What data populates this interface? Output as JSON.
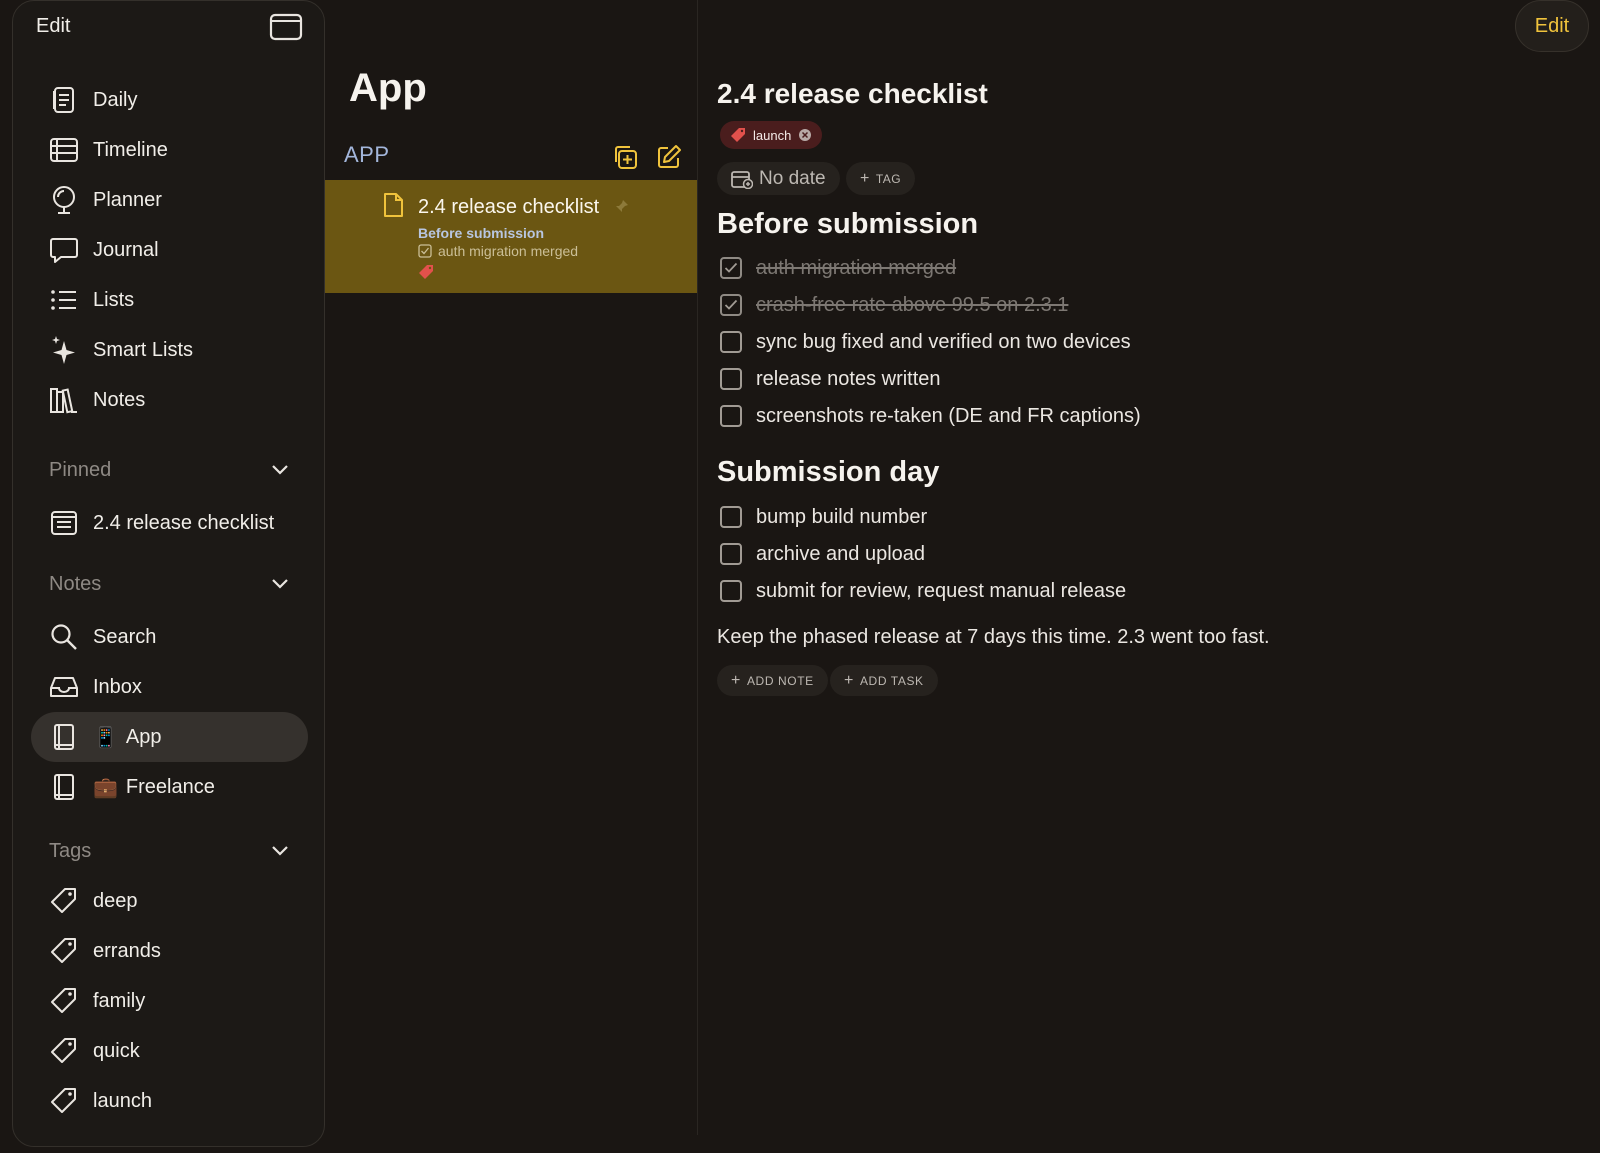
{
  "sidebar": {
    "edit_label": "Edit",
    "nav": [
      {
        "label": "Daily",
        "icon": "daily-icon"
      },
      {
        "label": "Timeline",
        "icon": "timeline-icon"
      },
      {
        "label": "Planner",
        "icon": "planner-icon"
      },
      {
        "label": "Journal",
        "icon": "journal-icon"
      },
      {
        "label": "Lists",
        "icon": "lists-icon"
      },
      {
        "label": "Smart Lists",
        "icon": "sparkle-icon"
      },
      {
        "label": "Notes",
        "icon": "books-icon"
      }
    ],
    "pinned": {
      "label": "Pinned",
      "items": [
        {
          "label": "2.4 release checklist",
          "icon": "note-icon"
        }
      ]
    },
    "notes": {
      "label": "Notes",
      "items": [
        {
          "label": "Search",
          "icon": "search-icon"
        },
        {
          "label": "Inbox",
          "icon": "inbox-icon"
        },
        {
          "label": "App",
          "emoji": "📱",
          "icon": "notebook-icon",
          "selected": true
        },
        {
          "label": "Freelance",
          "emoji": "💼",
          "icon": "notebook-icon"
        }
      ]
    },
    "tags": {
      "label": "Tags",
      "items": [
        {
          "label": "deep"
        },
        {
          "label": "errands"
        },
        {
          "label": "family"
        },
        {
          "label": "quick"
        },
        {
          "label": "launch"
        }
      ]
    }
  },
  "list": {
    "title": "App",
    "header": "APP",
    "notes": [
      {
        "title": "2.4 release checklist",
        "subtitle": "Before submission",
        "first_task": "auth migration merged"
      }
    ]
  },
  "detail": {
    "edit_label": "Edit",
    "title": "2.4 release checklist",
    "tag": "launch",
    "date_chip": "No date",
    "tag_chip": "TAG",
    "sections": [
      {
        "heading": "Before submission",
        "tasks": [
          {
            "text": "auth migration merged",
            "done": true
          },
          {
            "text": "crash-free rate above 99.5 on 2.3.1",
            "done": true
          },
          {
            "text": "sync bug fixed and verified on two devices",
            "done": false
          },
          {
            "text": "release notes written",
            "done": false
          },
          {
            "text": "screenshots re-taken (DE and FR captions)",
            "done": false
          }
        ]
      },
      {
        "heading": "Submission day",
        "tasks": [
          {
            "text": "bump build number",
            "done": false
          },
          {
            "text": "archive and upload",
            "done": false
          },
          {
            "text": "submit for review, request manual release",
            "done": false
          }
        ]
      }
    ],
    "paragraph": "Keep the phased release at 7 days this time. 2.3 went too fast.",
    "add_note": "ADD NOTE",
    "add_task": "ADD TASK"
  },
  "colors": {
    "accent": "#f0c33c",
    "selected_note_bg": "#6b5612",
    "tag_red": "#e2514c"
  }
}
